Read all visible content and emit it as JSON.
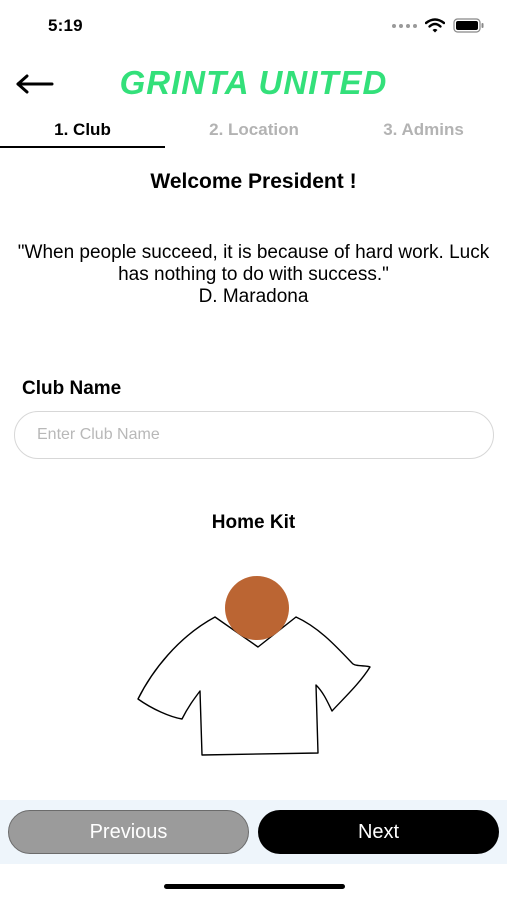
{
  "status_bar": {
    "time": "5:19",
    "icons": [
      "cellular-signal-icon",
      "wifi-icon",
      "battery-icon"
    ]
  },
  "header": {
    "title": "GRINTA UNITED",
    "title_color": "#33e07a",
    "back_icon": "arrow-left-icon"
  },
  "steps": [
    {
      "label": "1. Club",
      "active": true
    },
    {
      "label": "2. Location",
      "active": false
    },
    {
      "label": "3. Admins",
      "active": false
    }
  ],
  "content": {
    "welcome": "Welcome President !",
    "quote_text": "\"When people succeed, it is because of hard work. Luck has nothing to do with success.\"",
    "quote_author": "D. Maradona",
    "club_name_label": "Club Name",
    "club_name_value": "",
    "club_name_placeholder": "Enter Club Name",
    "home_kit_label": "Home Kit",
    "kit_color_marker": "#bb6533"
  },
  "footer": {
    "previous_label": "Previous",
    "next_label": "Next"
  }
}
